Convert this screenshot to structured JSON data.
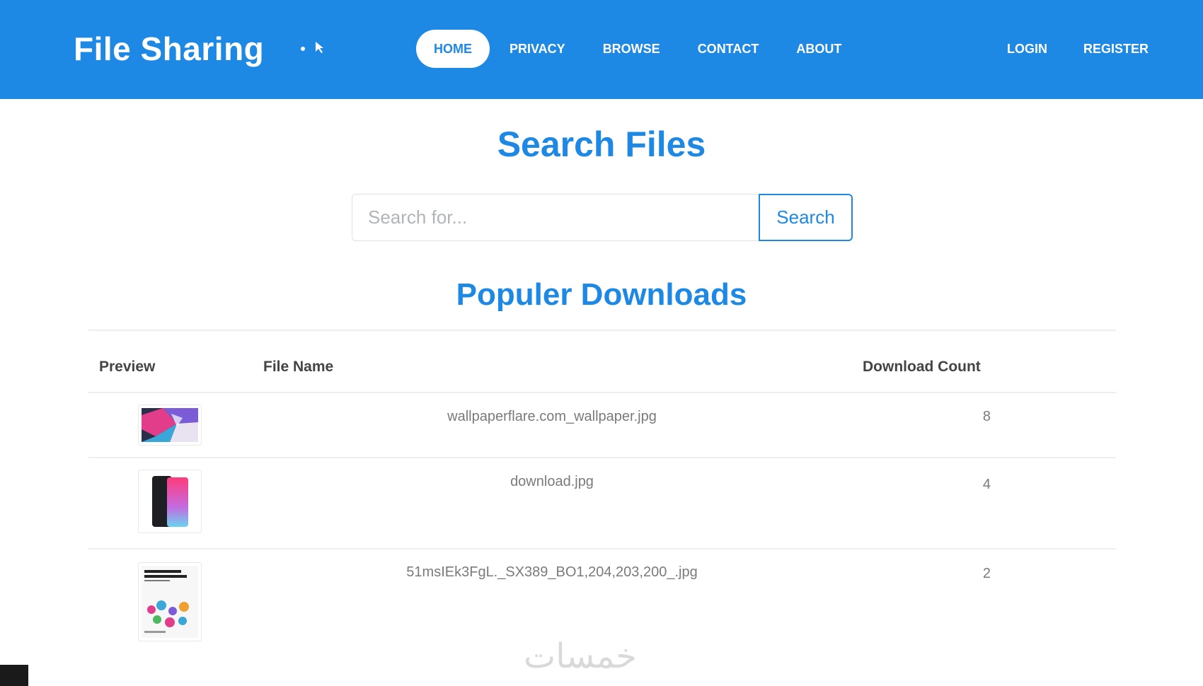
{
  "app": {
    "brand": "File Sharing"
  },
  "nav": {
    "links": [
      "HOME",
      "PRIVACY",
      "BROWSE",
      "CONTACT",
      "ABOUT"
    ],
    "right": [
      "LOGIN",
      "REGISTER"
    ]
  },
  "search": {
    "title": "Search Files",
    "placeholder": "Search for...",
    "button": "Search"
  },
  "popular": {
    "title": "Populer Downloads",
    "headers": {
      "preview": "Preview",
      "file_name": "File Name",
      "download_count": "Download Count"
    },
    "rows": [
      {
        "name": "wallpaperflare.com_wallpaper.jpg",
        "count": "8"
      },
      {
        "name": "download.jpg",
        "count": "4"
      },
      {
        "name": "51msIEk3FgL._SX389_BO1,204,203,200_.jpg",
        "count": "2"
      }
    ]
  },
  "colors": {
    "primary": "#1e88e5",
    "text_muted": "#7a7a7a"
  },
  "watermark": "خمسات"
}
